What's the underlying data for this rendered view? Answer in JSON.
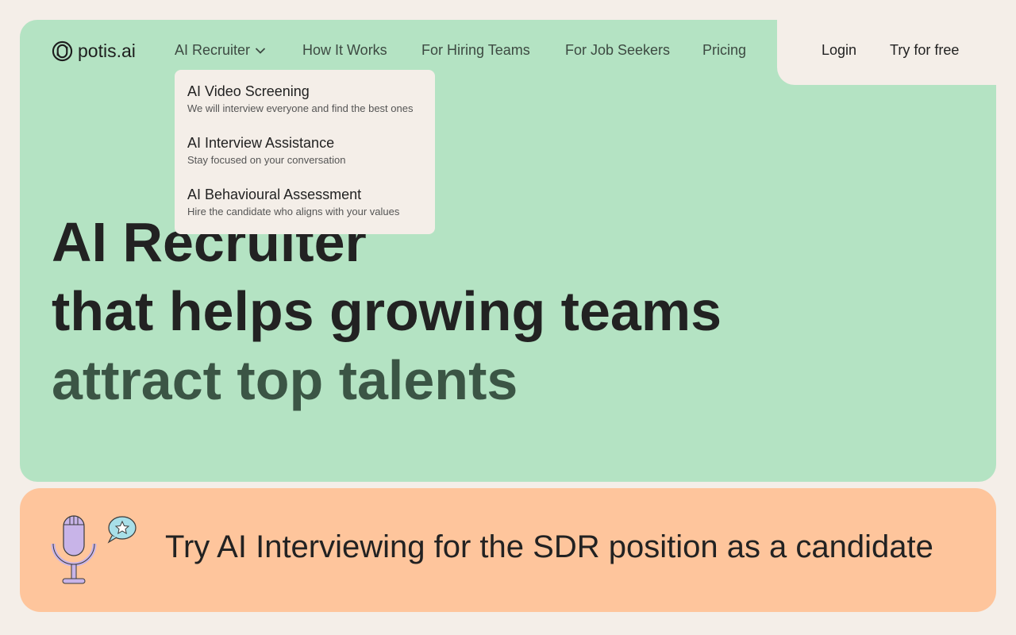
{
  "brand": {
    "name": "potis.ai",
    "logo_icon": "aperture-logo-icon"
  },
  "nav": {
    "items": [
      {
        "label": "AI Recruiter",
        "has_dropdown": true
      },
      {
        "label": "How It Works"
      },
      {
        "label": "For Hiring Teams"
      },
      {
        "label": "For Job Seekers"
      },
      {
        "label": "Pricing"
      }
    ],
    "login": "Login",
    "try_free": "Try for free"
  },
  "dropdown": {
    "items": [
      {
        "title": "AI Video Screening",
        "desc": "We will interview everyone and find the best ones"
      },
      {
        "title": "AI Interview Assistance",
        "desc": "Stay focused on your conversation"
      },
      {
        "title": "AI Behavioural Assessment",
        "desc": "Hire the candidate who aligns with your values"
      }
    ]
  },
  "hero": {
    "line1": "AI Recruiter",
    "line2": "that helps growing teams",
    "line3": "attract top talents"
  },
  "banner": {
    "text": "Try AI Interviewing for the SDR position as a candidate",
    "icon": "microphone-icon"
  },
  "colors": {
    "background": "#f4eee8",
    "hero": "#b4e3c3",
    "accent_text": "#3b5545",
    "banner": "#fec59c",
    "mic": "#c8b4e8",
    "bubble": "#a8dfe8"
  }
}
